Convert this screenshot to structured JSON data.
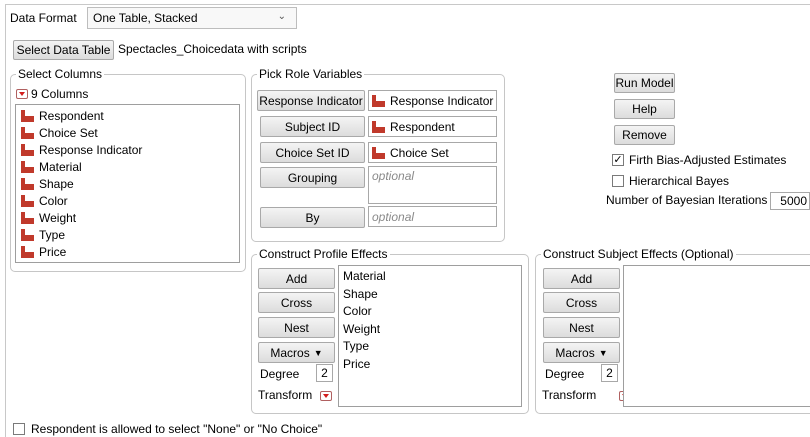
{
  "data_format": {
    "label": "Data Format",
    "value": "One Table, Stacked"
  },
  "data_table": {
    "button": "Select Data Table",
    "name": "Spectacles_Choicedata with scripts"
  },
  "select_columns": {
    "title": "Select Columns",
    "count": "9 Columns",
    "items": [
      "Respondent",
      "Choice Set",
      "Response Indicator",
      "Material",
      "Shape",
      "Color",
      "Weight",
      "Type",
      "Price"
    ]
  },
  "roles": {
    "title": "Pick Role Variables",
    "response_indicator": {
      "button": "Response Indicator",
      "value": "Response Indicator"
    },
    "subject_id": {
      "button": "Subject ID",
      "value": "Respondent"
    },
    "choice_set_id": {
      "button": "Choice Set ID",
      "value": "Choice Set"
    },
    "grouping": {
      "button": "Grouping",
      "placeholder": "optional"
    },
    "by": {
      "button": "By",
      "placeholder": "optional"
    }
  },
  "actions": {
    "run_model": "Run Model",
    "help": "Help",
    "remove": "Remove",
    "firth": {
      "label": "Firth Bias-Adjusted Estimates",
      "checked": true
    },
    "hier_bayes": {
      "label": "Hierarchical Bayes",
      "checked": false
    },
    "iterations": {
      "label": "Number of Bayesian Iterations",
      "value": "5000"
    }
  },
  "profile_effects": {
    "title": "Construct Profile Effects",
    "add": "Add",
    "cross": "Cross",
    "nest": "Nest",
    "macros": "Macros",
    "degree_label": "Degree",
    "degree_value": "2",
    "transform_label": "Transform",
    "items": [
      "Material",
      "Shape",
      "Color",
      "Weight",
      "Type",
      "Price"
    ]
  },
  "subject_effects": {
    "title": "Construct Subject Effects (Optional)",
    "add": "Add",
    "cross": "Cross",
    "nest": "Nest",
    "macros": "Macros",
    "degree_label": "Degree",
    "degree_value": "2",
    "transform_label": "Transform"
  },
  "no_choice": {
    "label": "Respondent is allowed to select \"None\" or \"No Choice\"",
    "checked": false
  },
  "colors": {
    "column_icon": "#c0392b",
    "accent_red": "#d41c1c"
  }
}
